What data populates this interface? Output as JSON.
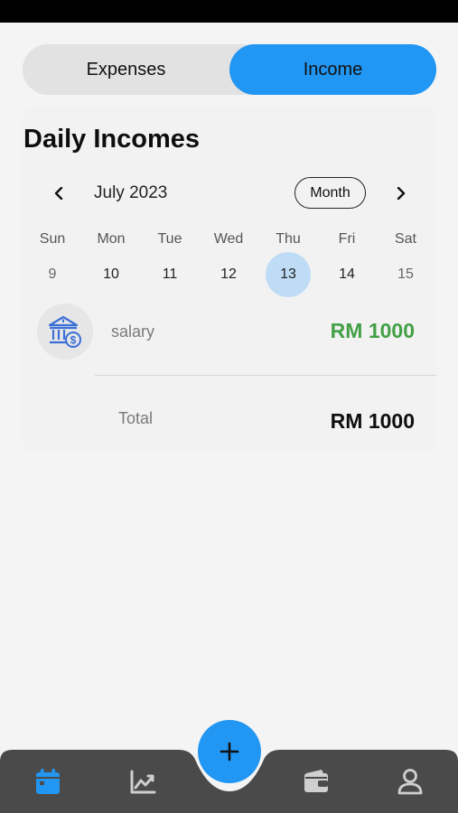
{
  "tabs": [
    {
      "label": "Expenses",
      "active": false
    },
    {
      "label": "Income",
      "active": true
    }
  ],
  "page_title": "Daily Incomes",
  "calendar": {
    "month_label": "July 2023",
    "view_button": "Month",
    "weekdays": [
      "Sun",
      "Mon",
      "Tue",
      "Wed",
      "Thu",
      "Fri",
      "Sat"
    ],
    "dates": [
      "9",
      "10",
      "11",
      "12",
      "13",
      "14",
      "15"
    ],
    "selected_date": "13"
  },
  "entries": [
    {
      "icon": "bank-dollar-icon",
      "label": "salary",
      "amount": "RM 1000"
    }
  ],
  "total": {
    "label": "Total",
    "amount": "RM 1000"
  },
  "nav": {
    "items": [
      "calendar-icon",
      "chart-icon",
      "add-icon",
      "wallet-icon",
      "profile-icon"
    ],
    "active": "calendar-icon"
  },
  "colors": {
    "accent": "#2196f3",
    "selected_day": "#bfdcf6",
    "income_amount": "#43a047",
    "nav_bar": "#4a4a4a",
    "nav_icon": "#cfcfcf"
  }
}
